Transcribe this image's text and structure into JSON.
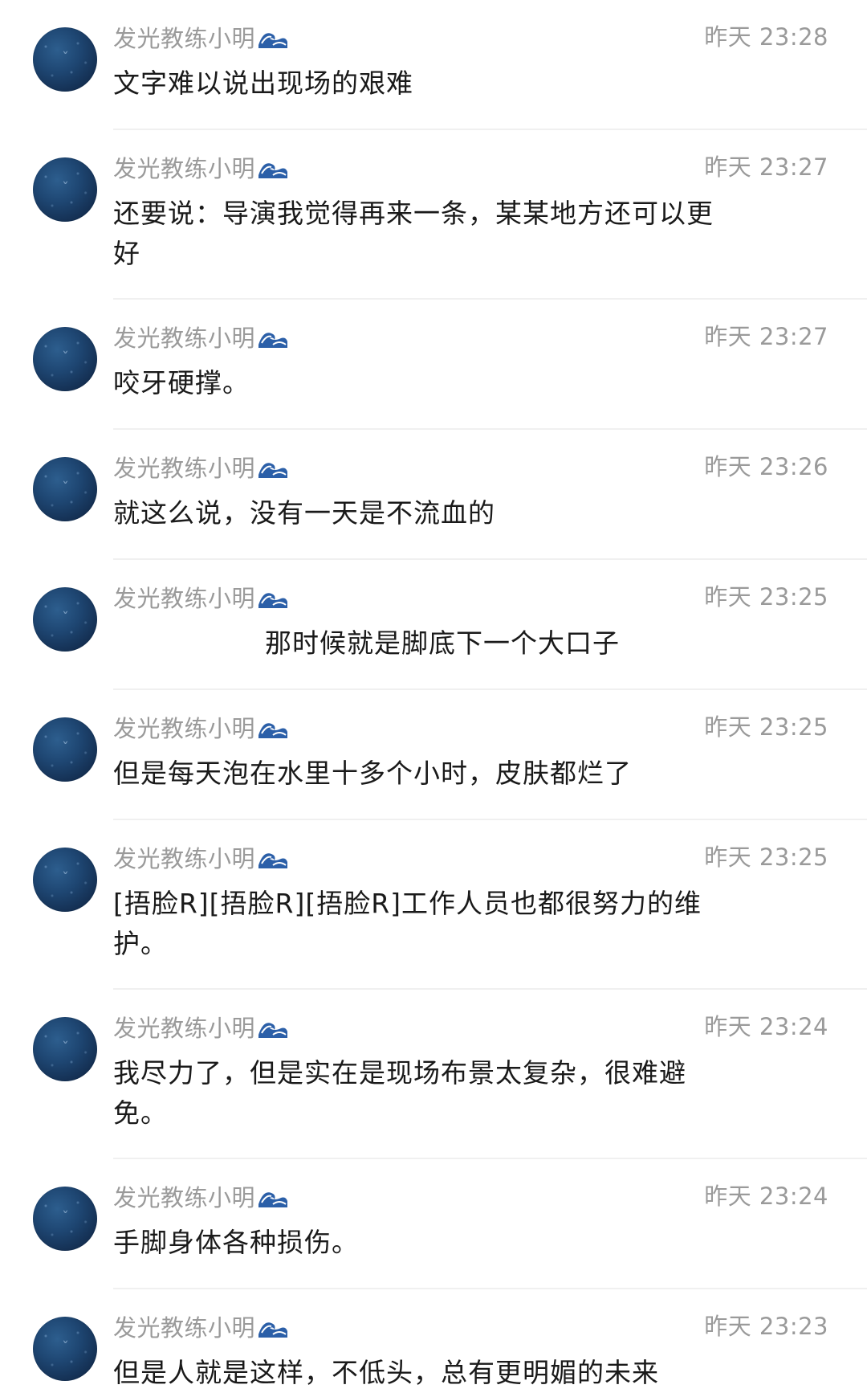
{
  "messages": [
    {
      "author": "发光教练小明",
      "time": "昨天 23:28",
      "text": "文字难以说出现场的艰难"
    },
    {
      "author": "发光教练小明",
      "time": "昨天 23:27",
      "text": "还要说：导演我觉得再来一条，某某地方还可以更好"
    },
    {
      "author": "发光教练小明",
      "time": "昨天 23:27",
      "text": "咬牙硬撑。"
    },
    {
      "author": "发光教练小明",
      "time": "昨天 23:26",
      "text": "就这么说，没有一天是不流血的"
    },
    {
      "author": "发光教练小明",
      "time": "昨天 23:25",
      "text": "那时候就是脚底下一个大口子"
    },
    {
      "author": "发光教练小明",
      "time": "昨天 23:25",
      "text": "但是每天泡在水里十多个小时，皮肤都烂了"
    },
    {
      "author": "发光教练小明",
      "time": "昨天 23:25",
      "text": "[捂脸R][捂脸R][捂脸R]工作人员也都很努力的维护。"
    },
    {
      "author": "发光教练小明",
      "time": "昨天 23:24",
      "text": "我尽力了，但是实在是现场布景太复杂，很难避免。"
    },
    {
      "author": "发光教练小明",
      "time": "昨天 23:24",
      "text": "手脚身体各种损伤。"
    },
    {
      "author": "发光教练小明",
      "time": "昨天 23:23",
      "text": "但是人就是这样，不低头，总有更明媚的未来"
    }
  ],
  "icons": {
    "avatar": "avatar-icon",
    "name_badge": "wave-icon"
  },
  "colors": {
    "meta_text": "#9a9a9a",
    "body_text": "#1a1a1a",
    "divider": "#f0f0f0",
    "avatar": "#1e4672"
  }
}
